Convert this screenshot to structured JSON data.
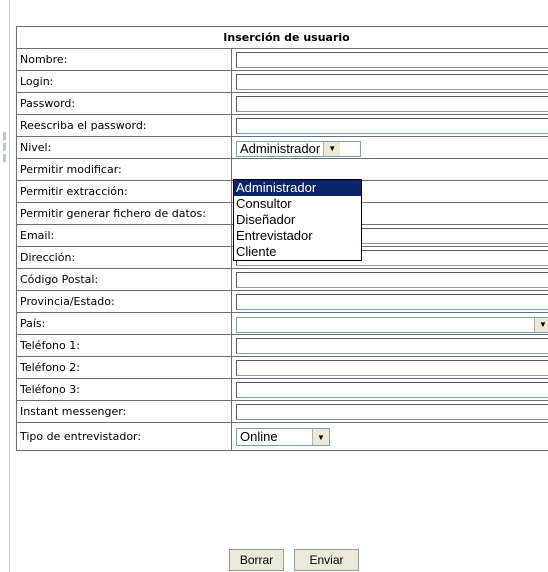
{
  "form": {
    "title": "Inserción de usuario",
    "fields": [
      {
        "label": "Nombre:",
        "type": "text",
        "value": ""
      },
      {
        "label": "Login:",
        "type": "text",
        "value": ""
      },
      {
        "label": "Password:",
        "type": "text",
        "value": ""
      },
      {
        "label": "Reescriba el password:",
        "type": "text",
        "value": ""
      },
      {
        "label": "Nivel:",
        "type": "select",
        "value": "Administrador"
      },
      {
        "label": "Permitir modificar:",
        "type": "hidden"
      },
      {
        "label": "Permitir extracción:",
        "type": "hidden"
      },
      {
        "label": "Permitir generar fichero de datos:",
        "type": "hidden"
      },
      {
        "label": "Email:",
        "type": "text",
        "value": ""
      },
      {
        "label": "Dirección:",
        "type": "text",
        "value": ""
      },
      {
        "label": "Código Postal:",
        "type": "text",
        "value": ""
      },
      {
        "label": "Provincia/Estado:",
        "type": "text",
        "value": ""
      },
      {
        "label": "País:",
        "type": "select",
        "value": ""
      },
      {
        "label": "Teléfono 1:",
        "type": "text",
        "value": ""
      },
      {
        "label": "Teléfono 2:",
        "type": "text",
        "value": ""
      },
      {
        "label": "Teléfono 3:",
        "type": "text",
        "value": ""
      },
      {
        "label": "Instant messenger:",
        "type": "text",
        "value": ""
      },
      {
        "label": "Tipo de entrevistador:",
        "type": "select",
        "value": "Online"
      }
    ]
  },
  "nivel_dropdown": {
    "options": [
      "Administrador",
      "Consultor",
      "Diseñador",
      "Entrevistador",
      "Cliente"
    ],
    "selected": "Administrador",
    "highlight_color": "#0a246a"
  },
  "buttons": {
    "clear_label": "Borrar",
    "submit_label": "Enviar"
  }
}
